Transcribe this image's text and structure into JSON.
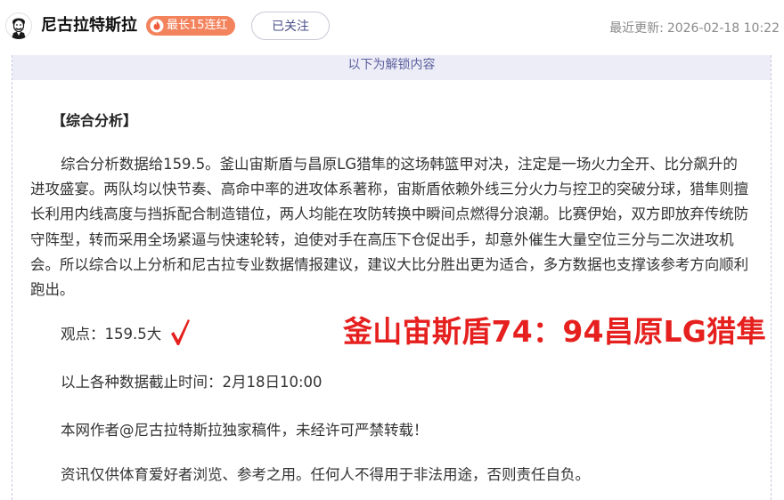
{
  "header": {
    "author_name": "尼古拉特斯拉",
    "streak_badge": "最长15连红",
    "follow_button": "已关注",
    "updated_label": "最近更新:",
    "updated_time": "2026-02-18 10:22"
  },
  "content": {
    "unlock_banner": "以下为解锁内容",
    "section_title": "【综合分析】",
    "analysis_paragraph": "综合分析数据给159.5。釜山宙斯盾与昌原LG猎隼的这场韩篮甲对决，注定是一场火力全开、比分飙升的进攻盛宴。两队均以快节奏、高命中率的进攻体系著称，宙斯盾依赖外线三分火力与控卫的突破分球，猎隼则擅长利用内线高度与挡拆配合制造错位，两人均能在攻防转换中瞬间点燃得分浪潮。比赛伊始，双方即放弃传统防守阵型，转而采用全场紧逼与快速轮转，迫使对手在高压下仓促出手，却意外催生大量空位三分与二次进攻机会。所以综合以上分析和尼古拉专业数据情报建议，建议大比分胜出更为适合，多方数据也支撑该参考方向顺利跑出。",
    "opinion": "观点：159.5大",
    "check_mark": "√",
    "result_score": "釜山宙斯盾74：94昌原LG猎隼",
    "cutoff_time": "以上各种数据截止时间：2月18日10:00",
    "copyright": "本网作者@尼古拉特斯拉独家稿件，未经许可严禁转载！",
    "disclaimer": "资讯仅供体育爱好者浏览、参考之用。任何人不得用于非法用途，否则责任自负。"
  },
  "colors": {
    "badge_bg": "#f3835d",
    "banner_bg": "#ededf8",
    "result_red": "#e5201e",
    "check_red": "#e5201e"
  },
  "icons": {
    "avatar": "tesla-portrait-avatar-icon",
    "badge": "flame-icon",
    "check": "check-mark-icon"
  }
}
